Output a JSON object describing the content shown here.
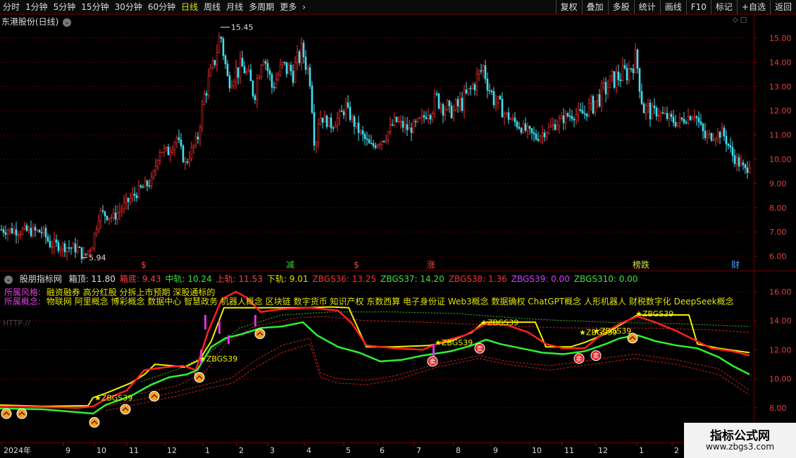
{
  "toolbar": {
    "periods": [
      "分时",
      "1分钟",
      "5分钟",
      "15分钟",
      "30分钟",
      "60分钟",
      "日线",
      "周线",
      "月线",
      "多周期",
      "更多"
    ],
    "active_index": 6,
    "right_buttons": [
      "复权",
      "叠加",
      "多股",
      "统计",
      "画线",
      "F10",
      "标记",
      "+自选",
      "返回"
    ]
  },
  "main_chart": {
    "title": "东港股份(日线)",
    "high_label": "15.45",
    "low_label": "5.94",
    "y_ticks": [
      "15.00",
      "14.00",
      "13.00",
      "12.00",
      "11.00",
      "10.00",
      "9.00",
      "8.00",
      "7.00",
      "6.00"
    ],
    "event_markers": [
      {
        "text": "$",
        "color": "#ff4040"
      },
      {
        "text": "减",
        "color": "#40d040"
      },
      {
        "text": "$",
        "color": "#ff4040"
      },
      {
        "text": "涨",
        "color": "#ff4040"
      },
      {
        "text": "榜跌",
        "color": "#e0e040"
      },
      {
        "text": "财",
        "color": "#40a0ff"
      }
    ]
  },
  "indicator": {
    "name": "股朋指标网",
    "values": [
      {
        "label": "箱顶: 11.80",
        "color": "#e0e0e0"
      },
      {
        "label": "箱底: 9.43",
        "color": "#ff4040"
      },
      {
        "label": "中轨: 10.24",
        "color": "#40e040"
      },
      {
        "label": "上轨: 11.53",
        "color": "#ff4040"
      },
      {
        "label": "下轨: 9.01",
        "color": "#e0e000"
      },
      {
        "label": "ZBGS36: 13.25",
        "color": "#ff3030"
      },
      {
        "label": "ZBGS37: 14.20",
        "color": "#40e040"
      },
      {
        "label": "ZBGS38: 1.36",
        "color": "#ff3030"
      },
      {
        "label": "ZBGS39: 0.00",
        "color": "#d040ff"
      },
      {
        "label": "ZBGS310: 0.00",
        "color": "#40e040"
      }
    ],
    "style_label": "所属风格:",
    "style_text": "融资融券 高分红股 分拆上市预期 深股通标的",
    "concept_label": "所属概念:",
    "concept_text": "物联网 阿里概念 博彩概念 数据中心 智慧政务 机器人概念 区块链 数字货币 知识产权 东数西算 电子身份证 Web3概念 数据确权 ChatGPT概念 人形机器人 财税数字化 DeepSeek概念",
    "http_text": "HTTP://",
    "signal_label": "ZBGS39",
    "y_ticks": [
      "16.00",
      "14.00",
      "12.00",
      "10.00",
      "8.00"
    ]
  },
  "x_axis": {
    "labels": [
      "2024年",
      "9",
      "10",
      "11",
      "12",
      "1",
      "2",
      "3",
      "4",
      "5",
      "6",
      "7",
      "8",
      "9",
      "10",
      "11",
      "12",
      "1",
      "2"
    ]
  },
  "watermark": {
    "line1": "指标公式网",
    "line2": "www.zbgs3.com"
  }
}
